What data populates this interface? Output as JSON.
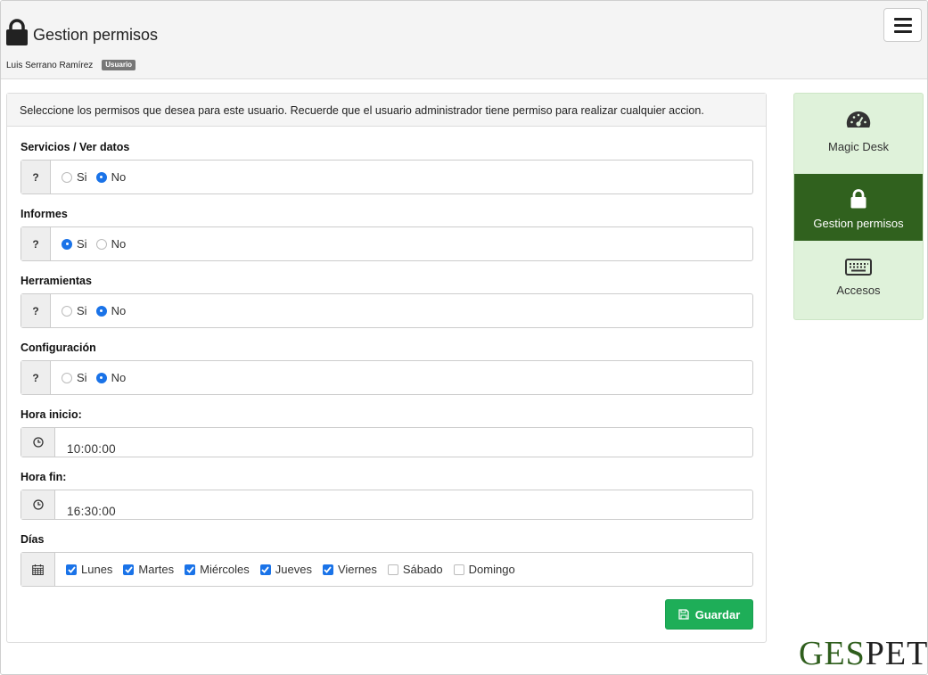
{
  "header": {
    "title": "Gestion permisos",
    "user_name": "Luis Serrano Ramírez",
    "role_badge": "Usuario"
  },
  "panel": {
    "intro": "Seleccione los permisos que desea para este usuario. Recuerde que el usuario administrador tiene permiso para realizar cualquier accion.",
    "permissions": [
      {
        "label": "Servicios / Ver datos",
        "help": "?",
        "yes_label": "Si",
        "no_label": "No",
        "selected": "No"
      },
      {
        "label": "Informes",
        "help": "?",
        "yes_label": "Si",
        "no_label": "No",
        "selected": "Si"
      },
      {
        "label": "Herramientas",
        "help": "?",
        "yes_label": "Si",
        "no_label": "No",
        "selected": "No"
      },
      {
        "label": "Configuración",
        "help": "?",
        "yes_label": "Si",
        "no_label": "No",
        "selected": "No"
      }
    ],
    "hora_inicio": {
      "label": "Hora inicio:",
      "value": "10:00:00"
    },
    "hora_fin": {
      "label": "Hora fin:",
      "value": "16:30:00"
    },
    "dias": {
      "label": "Días",
      "items": [
        {
          "label": "Lunes",
          "checked": true
        },
        {
          "label": "Martes",
          "checked": true
        },
        {
          "label": "Miércoles",
          "checked": true
        },
        {
          "label": "Jueves",
          "checked": true
        },
        {
          "label": "Viernes",
          "checked": true
        },
        {
          "label": "Sábado",
          "checked": false
        },
        {
          "label": "Domingo",
          "checked": false
        }
      ]
    },
    "save_label": "Guardar"
  },
  "sidenav": {
    "items": [
      {
        "label": "Magic Desk",
        "icon": "dashboard-icon",
        "active": false
      },
      {
        "label": "Gestion permisos",
        "icon": "lock-icon",
        "active": true
      },
      {
        "label": "Accesos",
        "icon": "keyboard-icon",
        "active": false
      }
    ]
  },
  "logo": {
    "part1": "GES",
    "part2": "PET"
  },
  "colors": {
    "accent_blue": "#1a73e8",
    "save_green": "#1eae58",
    "nav_active": "#30611e",
    "nav_bg": "#dff2da",
    "logo_green": "#2f5e1d"
  }
}
